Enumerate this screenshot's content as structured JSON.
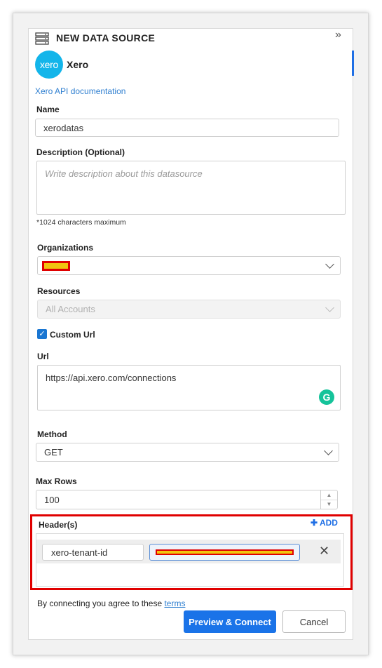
{
  "header": {
    "title": "NEW DATA SOURCE",
    "icon": "datasource-icon",
    "collapse_icon": "double-chevron-right-icon"
  },
  "provider": {
    "logo_text": "xero",
    "name": "Xero",
    "doc_link": "Xero API documentation",
    "brand_color": "#13b5ea"
  },
  "form": {
    "name_label": "Name",
    "name_value": "xerodatas",
    "description_label": "Description (Optional)",
    "description_placeholder": "Write description about this datasource",
    "char_limit_note": "*1024 characters maximum",
    "organizations_label": "Organizations",
    "resources_label": "Resources",
    "resources_value": "All Accounts",
    "custom_url_label": "Custom Url",
    "custom_url_checked": true,
    "url_label": "Url",
    "url_value": "https://api.xero.com/connections",
    "method_label": "Method",
    "method_value": "GET",
    "max_rows_label": "Max Rows",
    "max_rows_value": "100"
  },
  "headers_section": {
    "label": "Header(s)",
    "add_label": "ADD",
    "rows": [
      {
        "key": "xero-tenant-id"
      }
    ]
  },
  "footer": {
    "terms_text": "By connecting you agree to these ",
    "terms_link": "terms",
    "primary_button": "Preview & Connect",
    "cancel_button": "Cancel",
    "accent_color": "#1a73e8"
  }
}
